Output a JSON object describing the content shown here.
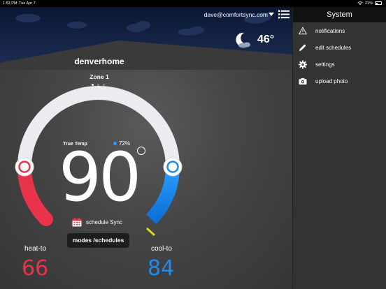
{
  "status_bar": {
    "time": "1:53 PM",
    "date": "Tue Apr 7",
    "battery": "21%"
  },
  "header": {
    "user_email": "dave@comfortsync.com"
  },
  "weather": {
    "temperature": "46°",
    "icon": "moon-cloud-icon"
  },
  "thermostat": {
    "location": "denverhome",
    "zone": "Zone 1",
    "zone_pages": 3,
    "active_zone_page": 1,
    "true_temp_label": "True Temp",
    "humidity": "72%",
    "current_temp": "90",
    "schedule_label": "schedule Sync",
    "modes_button": "modes /schedules",
    "heat_label": "heat-to",
    "heat_value": "66",
    "cool_label": "cool-to",
    "cool_value": "84"
  },
  "colors": {
    "heat": "#e8334a",
    "cool": "#1d8cf0",
    "panel": "#333333"
  },
  "side_panel": {
    "title": "System",
    "items": [
      {
        "label": "notifications",
        "icon": "warning-icon"
      },
      {
        "label": "edit schedules",
        "icon": "pencil-icon"
      },
      {
        "label": "settings",
        "icon": "gear-icon"
      },
      {
        "label": "upload photo",
        "icon": "camera-icon"
      }
    ]
  }
}
